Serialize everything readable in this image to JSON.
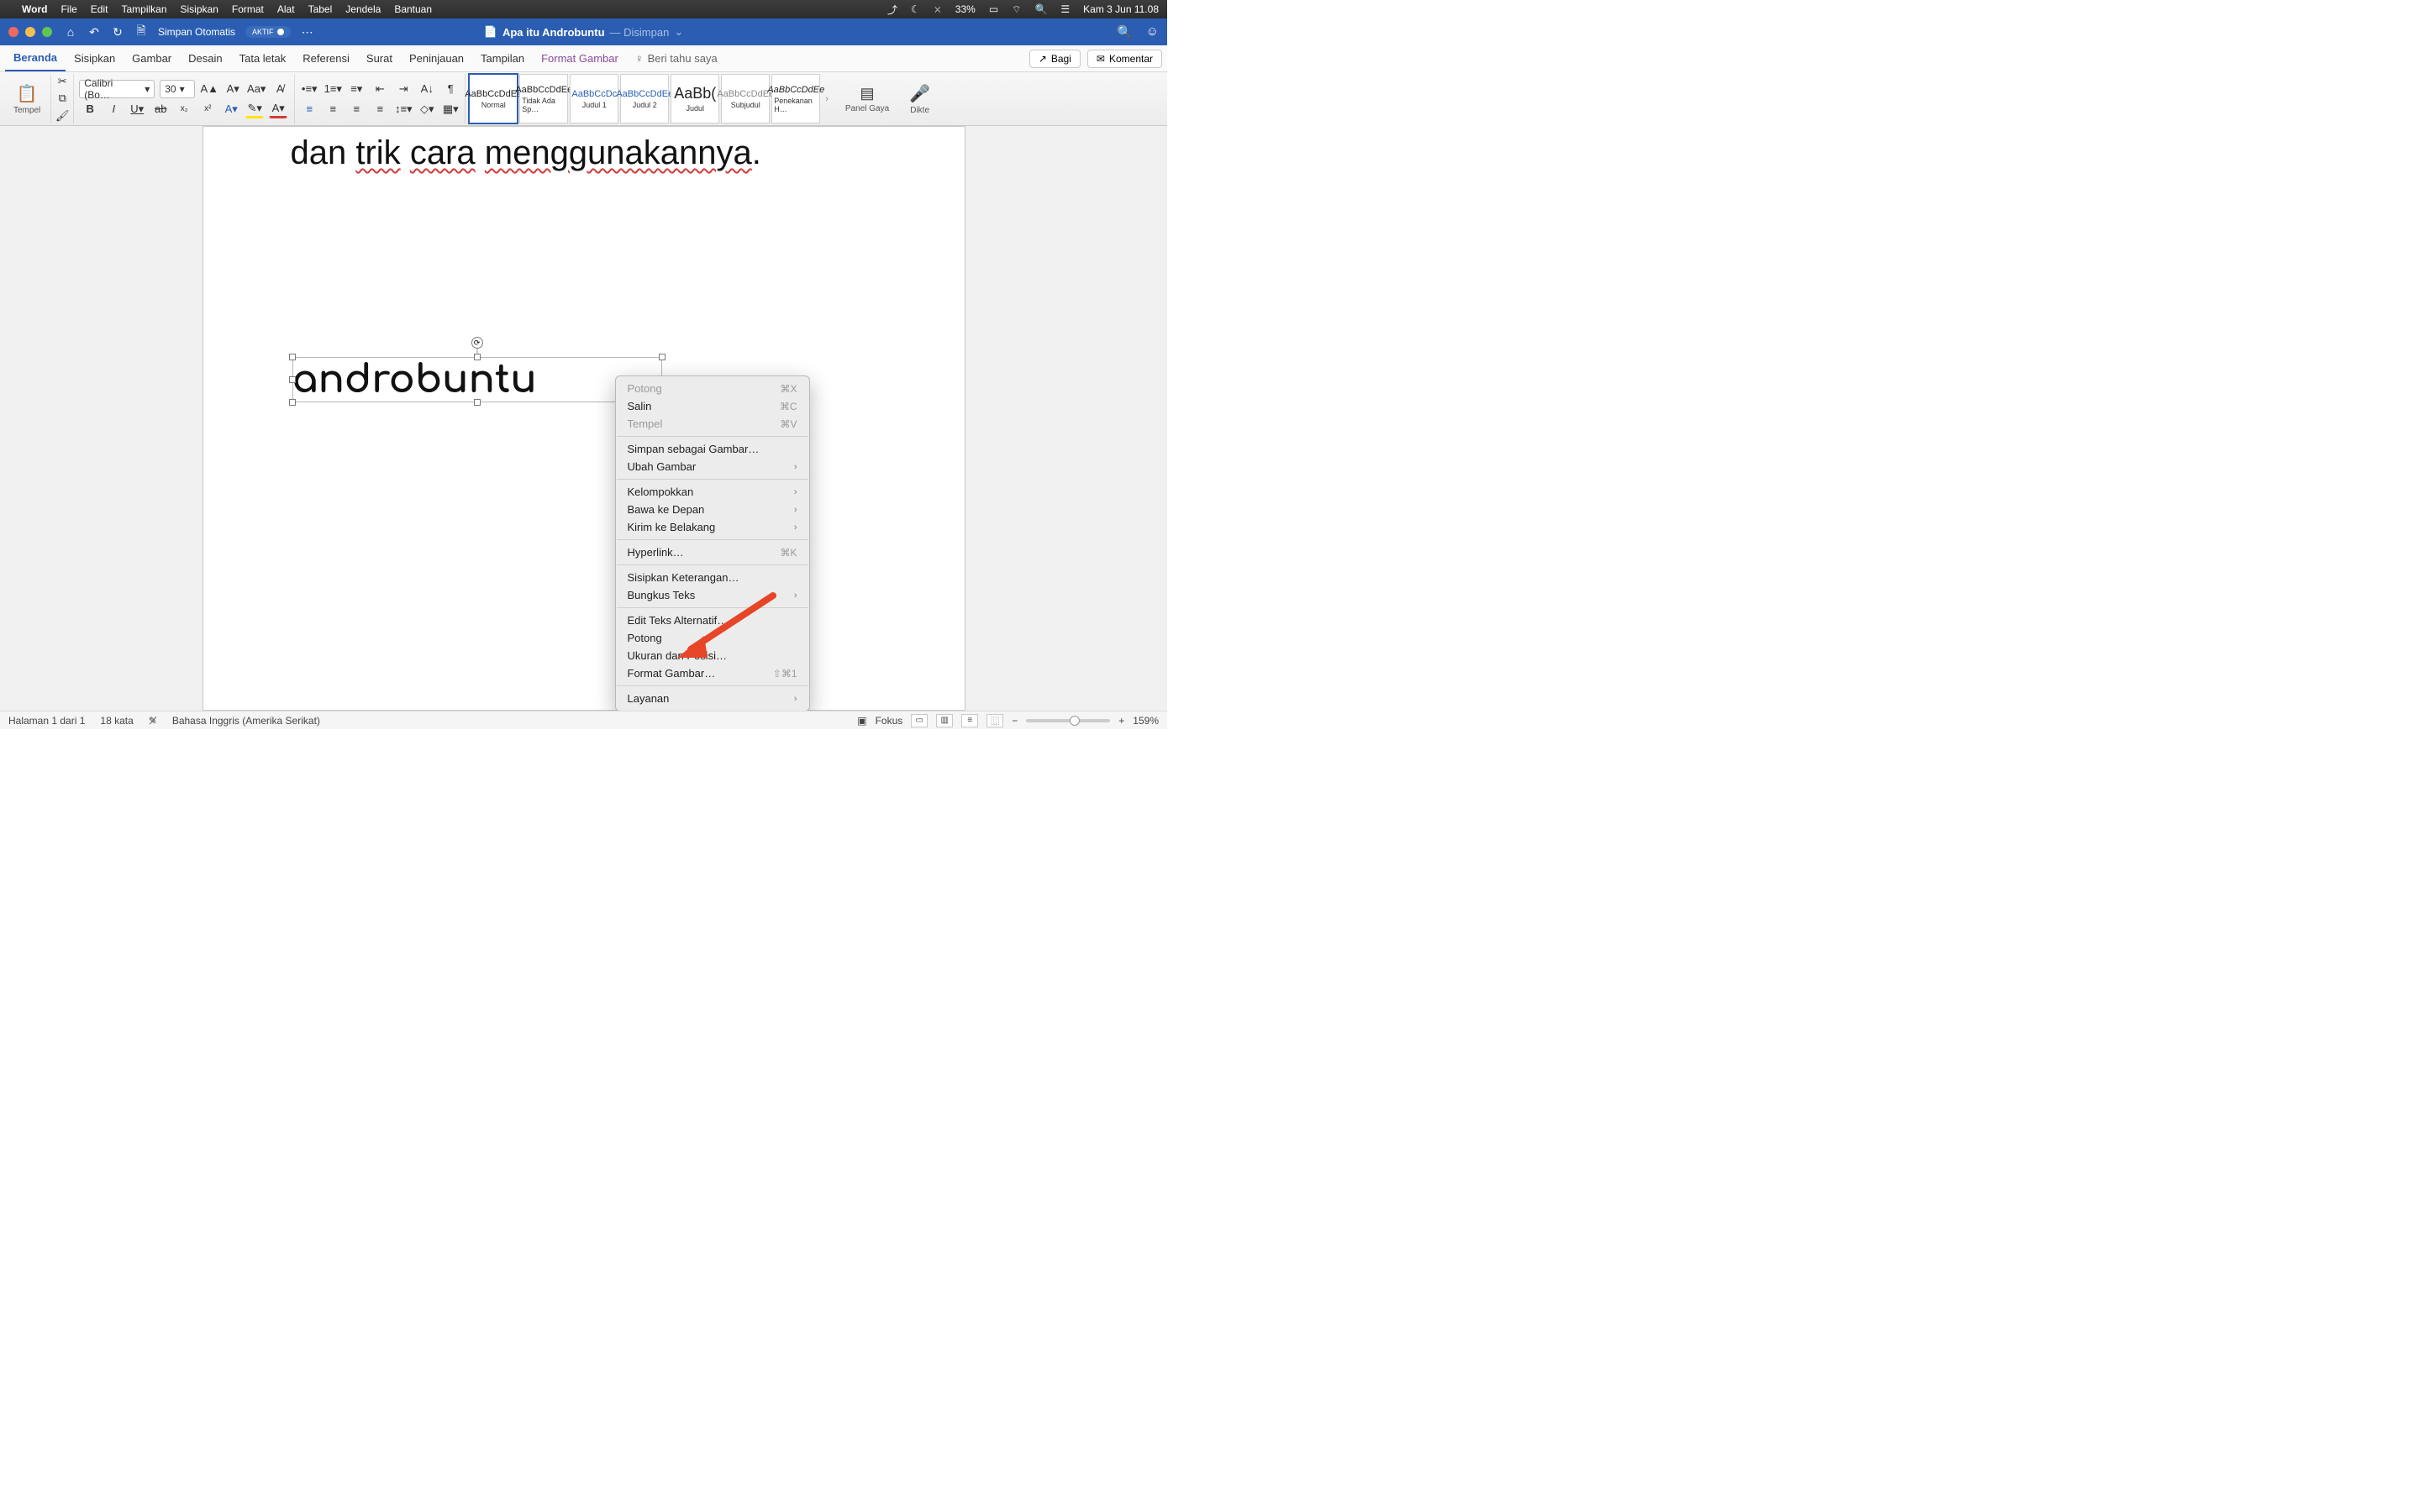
{
  "menubar": {
    "app": "Word",
    "items": [
      "File",
      "Edit",
      "Tampilkan",
      "Sisipkan",
      "Format",
      "Alat",
      "Tabel",
      "Jendela",
      "Bantuan"
    ],
    "battery": "33%",
    "datetime": "Kam 3 Jun  11.08"
  },
  "titlebar": {
    "autosave_label": "Simpan Otomatis",
    "autosave_state": "AKTIF",
    "doc_title": "Apa itu Androbuntu",
    "saved_suffix": "— Disimpan"
  },
  "tabs": {
    "items": [
      "Beranda",
      "Sisipkan",
      "Gambar",
      "Desain",
      "Tata letak",
      "Referensi",
      "Surat",
      "Peninjauan",
      "Tampilan",
      "Format Gambar"
    ],
    "tellme": "Beri tahu saya",
    "share": "Bagi",
    "comments": "Komentar"
  },
  "ribbon": {
    "paste": "Tempel",
    "font_name": "Calibri (Bo…",
    "font_size": "30",
    "styles": [
      {
        "preview": "AaBbCcDdEe",
        "name": "Normal"
      },
      {
        "preview": "AaBbCcDdEe",
        "name": "Tidak Ada Sp…"
      },
      {
        "preview": "AaBbCcDc",
        "name": "Judul 1"
      },
      {
        "preview": "AaBbCcDdEe",
        "name": "Judul 2"
      },
      {
        "preview": "AaBb(",
        "name": "Judul"
      },
      {
        "preview": "AaBbCcDdEe",
        "name": "Subjudul"
      },
      {
        "preview": "AaBbCcDdEe",
        "name": "Penekanan H…"
      }
    ],
    "panel_label": "Panel Gaya",
    "dictate": "Dikte"
  },
  "document": {
    "visible_line_prefix": "dan ",
    "w_trik": "trik",
    "sp": " ",
    "w_cara": "cara",
    "w_menggunakannya": "menggunakannya",
    "period": ".",
    "image_text": "androbuntu"
  },
  "context_menu": {
    "items": [
      {
        "label": "Potong",
        "shortcut": "⌘X",
        "dim": true
      },
      {
        "label": "Salin",
        "shortcut": "⌘C"
      },
      {
        "label": "Tempel",
        "shortcut": "⌘V",
        "dim": true
      },
      {
        "sep": true
      },
      {
        "label": "Simpan sebagai Gambar…"
      },
      {
        "label": "Ubah Gambar",
        "sub": true
      },
      {
        "sep": true
      },
      {
        "label": "Kelompokkan",
        "sub": true
      },
      {
        "label": "Bawa ke Depan",
        "sub": true
      },
      {
        "label": "Kirim ke Belakang",
        "sub": true
      },
      {
        "sep": true
      },
      {
        "label": "Hyperlink…",
        "shortcut": "⌘K"
      },
      {
        "sep": true
      },
      {
        "label": "Sisipkan Keterangan…"
      },
      {
        "label": "Bungkus Teks",
        "sub": true
      },
      {
        "sep": true
      },
      {
        "label": "Edit Teks Alternatif…"
      },
      {
        "label": "Potong"
      },
      {
        "label": "Ukuran dan Posisi…"
      },
      {
        "label": "Format Gambar…",
        "shortcut": "⇧⌘1"
      },
      {
        "sep": true
      },
      {
        "label": "Layanan",
        "sub": true
      }
    ]
  },
  "statusbar": {
    "page": "Halaman 1 dari 1",
    "words": "18 kata",
    "lang": "Bahasa Inggris (Amerika Serikat)",
    "focus": "Fokus",
    "zoom": "159%"
  }
}
